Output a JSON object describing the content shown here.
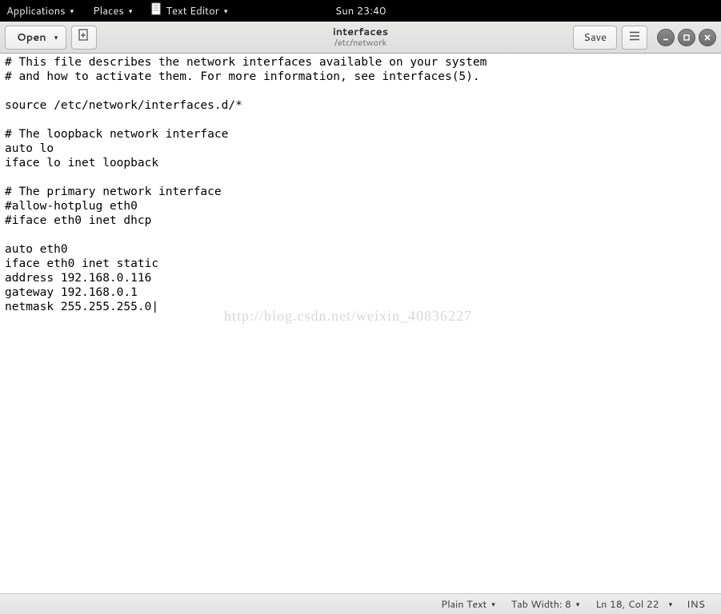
{
  "topbar": {
    "applications": "Applications",
    "places": "Places",
    "app_name": "Text Editor",
    "clock": "Sun 23:40"
  },
  "header": {
    "open": "Open",
    "title": "interfaces",
    "subtitle": "/etc/network",
    "save": "Save"
  },
  "editor": {
    "content": "# This file describes the network interfaces available on your system\n# and how to activate them. For more information, see interfaces(5).\n\nsource /etc/network/interfaces.d/*\n\n# The loopback network interface\nauto lo\niface lo inet loopback\n\n# The primary network interface\n#allow-hotplug eth0\n#iface eth0 inet dhcp\n\nauto eth0\niface eth0 inet static\naddress 192.168.0.116\ngateway 192.168.0.1\nnetmask 255.255.255.0"
  },
  "watermark": "http://blog.csdn.net/weixin_40836227",
  "status": {
    "syntax": "Plain Text",
    "tabwidth": "Tab Width: 8",
    "position": "Ln 18, Col 22",
    "insert": "INS"
  }
}
